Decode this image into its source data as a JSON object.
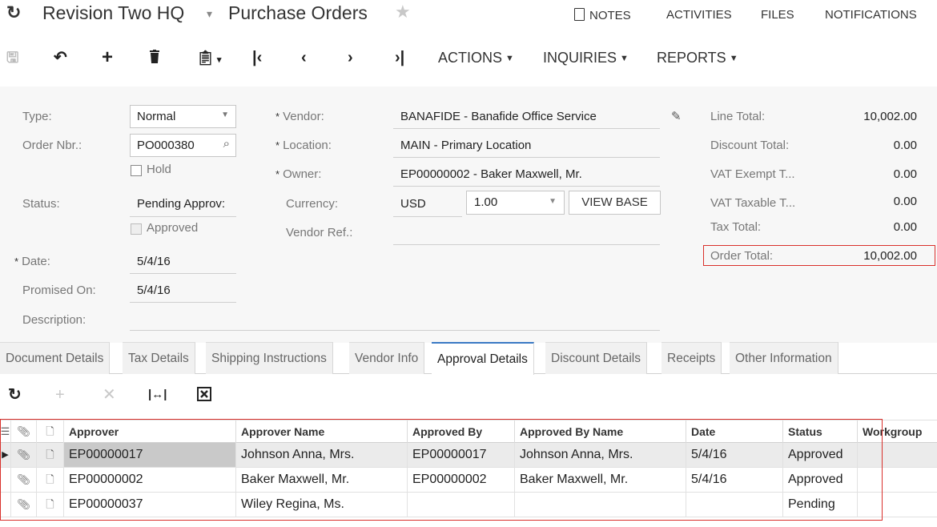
{
  "title": {
    "company": "Revision Two HQ",
    "screen": "Purchase Orders",
    "links": [
      "NOTES",
      "ACTIVITIES",
      "FILES",
      "NOTIFICATIONS"
    ]
  },
  "toolbar": {
    "menus": [
      "ACTIONS",
      "INQUIRIES",
      "REPORTS"
    ]
  },
  "form": {
    "type_label": "Type:",
    "type_value": "Normal",
    "order_nbr_label": "Order Nbr.:",
    "order_nbr_value": "PO000380",
    "hold_label": "Hold",
    "status_label": "Status:",
    "status_value": "Pending Approv:",
    "approved_label": "Approved",
    "date_label": "Date:",
    "date_value": "5/4/16",
    "promised_label": "Promised On:",
    "promised_value": "5/4/16",
    "description_label": "Description:",
    "vendor_label": "Vendor:",
    "vendor_value": "BANAFIDE - Banafide Office Service",
    "location_label": "Location:",
    "location_value": "MAIN - Primary Location",
    "owner_label": "Owner:",
    "owner_value": "EP00000002 - Baker Maxwell, Mr.",
    "currency_label": "Currency:",
    "currency_value": "USD",
    "rate_value": "1.00",
    "view_base_label": "VIEW BASE",
    "vendor_ref_label": "Vendor Ref.:",
    "line_total_label": "Line Total:",
    "line_total_value": "10,002.00",
    "discount_total_label": "Discount Total:",
    "discount_total_value": "0.00",
    "vat_exempt_label": "VAT Exempt T...",
    "vat_exempt_value": "0.00",
    "vat_taxable_label": "VAT Taxable T...",
    "vat_taxable_value": "0.00",
    "tax_total_label": "Tax Total:",
    "tax_total_value": "0.00",
    "order_total_label": "Order Total:",
    "order_total_value": "10,002.00"
  },
  "tabs": [
    "Document Details",
    "Tax Details",
    "Shipping Instructions",
    "Vendor Info",
    "Approval Details",
    "Discount Details",
    "Receipts",
    "Other Information"
  ],
  "grid": {
    "columns": [
      "Approver",
      "Approver Name",
      "Approved By",
      "Approved By Name",
      "Date",
      "Status",
      "Workgroup"
    ],
    "rows": [
      {
        "approver": "EP00000017",
        "approver_name": "Johnson Anna, Mrs.",
        "approved_by": "EP00000017",
        "approved_by_name": "Johnson Anna, Mrs.",
        "date": "5/4/16",
        "status": "Approved",
        "workgroup": ""
      },
      {
        "approver": "EP00000002",
        "approver_name": "Baker Maxwell, Mr.",
        "approved_by": "EP00000002",
        "approved_by_name": "Baker Maxwell, Mr.",
        "date": "5/4/16",
        "status": "Approved",
        "workgroup": ""
      },
      {
        "approver": "EP00000037",
        "approver_name": "Wiley Regina, Ms.",
        "approved_by": "",
        "approved_by_name": "",
        "date": "",
        "status": "Pending",
        "workgroup": ""
      }
    ]
  }
}
